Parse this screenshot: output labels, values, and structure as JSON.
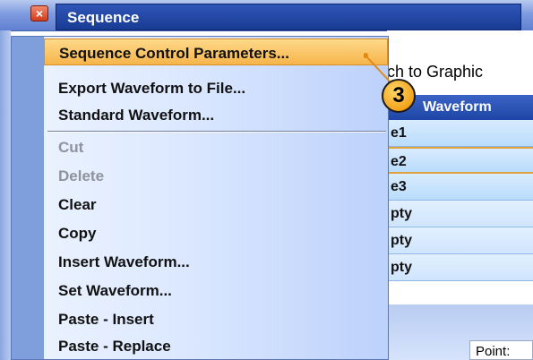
{
  "window": {
    "title": "Sequence",
    "close_glyph": "×"
  },
  "menu": {
    "items": [
      {
        "label": "Sequence Control Parameters...",
        "state": "highlighted"
      },
      {
        "label": "Export Waveform to File...",
        "state": "enabled"
      },
      {
        "label": "Standard Waveform...",
        "state": "enabled"
      },
      {
        "label": "Cut",
        "state": "disabled"
      },
      {
        "label": "Delete",
        "state": "disabled"
      },
      {
        "label": "Clear",
        "state": "enabled"
      },
      {
        "label": "Copy",
        "state": "enabled"
      },
      {
        "label": "Insert Waveform...",
        "state": "enabled"
      },
      {
        "label": "Set Waveform...",
        "state": "enabled"
      },
      {
        "label": "Paste - Insert",
        "state": "enabled"
      },
      {
        "label": "Paste - Replace",
        "state": "enabled"
      }
    ]
  },
  "background": {
    "switch_button_label": "ch to Graphic",
    "grid_header": "Waveform",
    "rows": [
      "e1",
      "e2",
      "e3",
      "pty",
      "pty",
      "pty"
    ],
    "selected_row_index": 1,
    "point_label": "Point:"
  },
  "callout": {
    "number": "3"
  },
  "colors": {
    "title_bar": "#1f46a5",
    "menu_highlight": "#f6b54b",
    "callout": "#f2a31a",
    "grid_row": "#b9dcfb"
  }
}
